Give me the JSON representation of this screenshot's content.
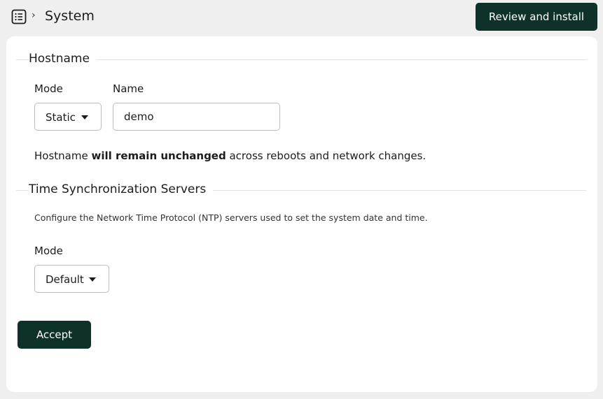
{
  "header": {
    "breadcrumb_separator": "›",
    "title": "System",
    "review_button": "Review and install"
  },
  "hostname": {
    "section_title": "Hostname",
    "mode_label": "Mode",
    "mode_value": "Static",
    "name_label": "Name",
    "name_value": "demo",
    "hint_prefix": "Hostname ",
    "hint_bold": "will remain unchanged",
    "hint_suffix": " across reboots and network changes."
  },
  "time_sync": {
    "section_title": "Time Synchronization Servers",
    "description": "Configure the Network Time Protocol (NTP) servers used to set the system date and time.",
    "mode_label": "Mode",
    "mode_value": "Default"
  },
  "actions": {
    "accept": "Accept"
  },
  "colors": {
    "primary_button": "#0e3129",
    "page_background": "#efefef",
    "panel_background": "#ffffff"
  },
  "icons": {
    "menu": "list-menu-icon",
    "breadcrumb": "chevron-right-icon",
    "dropdown": "caret-down-icon"
  }
}
